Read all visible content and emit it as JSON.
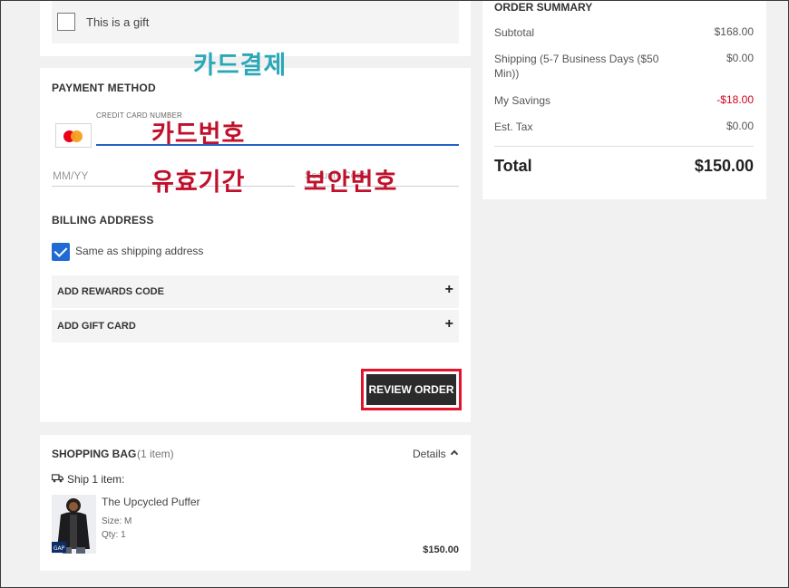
{
  "gift": {
    "label": "This is a gift"
  },
  "payment": {
    "title": "PAYMENT METHOD",
    "card_number_label": "CREDIT CARD NUMBER",
    "expiry_placeholder": "MM/YY",
    "security_placeholder": "Security Code"
  },
  "billing": {
    "title": "BILLING ADDRESS",
    "same_as_shipping_label": "Same as shipping address"
  },
  "accordions": {
    "rewards": "ADD REWARDS CODE",
    "gift_card": "ADD GIFT CARD",
    "expand_symbol": "+"
  },
  "review_button": "REVIEW ORDER",
  "bag": {
    "title": "SHOPPING BAG",
    "count": "(1 item)",
    "details_label": "Details",
    "ship_label": "Ship 1 item:",
    "product": {
      "name": "The Upcycled Puffer",
      "size": "Size: M",
      "qty": "Qty: 1",
      "price": "$150.00",
      "brand_mark": "GAP"
    }
  },
  "summary": {
    "title": "ORDER SUMMARY",
    "rows": [
      {
        "label": "Subtotal",
        "value": "$168.00"
      },
      {
        "label": "Shipping (5-7 Business Days ($50 Min))",
        "value": "$0.00"
      },
      {
        "label": "My Savings",
        "value": "-$18.00"
      },
      {
        "label": "Est. Tax",
        "value": "$0.00"
      }
    ],
    "total_label": "Total",
    "total_value": "$150.00"
  },
  "annotations": {
    "card_payment": "카드결제",
    "card_number": "카드번호",
    "expiry": "유효기간",
    "security_code": "보안번호"
  },
  "colors": {
    "accent_blue": "#1f6bd3",
    "highlight_red": "#e4132c",
    "savings_red": "#d0021b",
    "annotation_teal": "#2ba8b8",
    "annotation_red": "#c0102c"
  },
  "icons": [
    "checkbox",
    "mastercard-icon",
    "checkmark-icon",
    "plus-icon",
    "chevron-up-icon",
    "truck-icon"
  ]
}
